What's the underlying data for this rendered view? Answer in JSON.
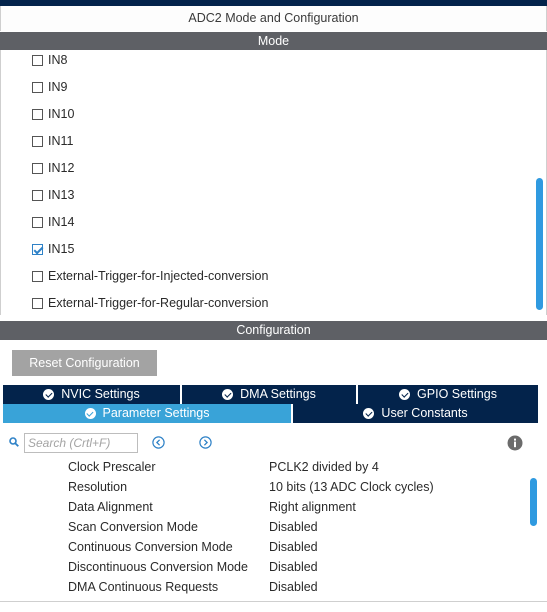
{
  "window": {
    "title": "ADC2 Mode and Configuration"
  },
  "mode": {
    "header": "Mode",
    "items": [
      {
        "label": "IN8",
        "checked": false
      },
      {
        "label": "IN9",
        "checked": false
      },
      {
        "label": "IN10",
        "checked": false
      },
      {
        "label": "IN11",
        "checked": false
      },
      {
        "label": "IN12",
        "checked": false
      },
      {
        "label": "IN13",
        "checked": false
      },
      {
        "label": "IN14",
        "checked": false
      },
      {
        "label": "IN15",
        "checked": true
      },
      {
        "label": "External-Trigger-for-Injected-conversion",
        "checked": false
      },
      {
        "label": "External-Trigger-for-Regular-conversion",
        "checked": false
      }
    ]
  },
  "configuration": {
    "header": "Configuration",
    "reset_button": "Reset Configuration",
    "tabs_row1": [
      {
        "label": "NVIC Settings",
        "icon": "check-circle-icon",
        "active": false
      },
      {
        "label": "DMA Settings",
        "icon": "check-circle-icon",
        "active": false
      },
      {
        "label": "GPIO Settings",
        "icon": "check-circle-icon",
        "active": false
      }
    ],
    "tabs_row2": [
      {
        "label": "Parameter Settings",
        "icon": "check-circle-icon",
        "active": true
      },
      {
        "label": "User Constants",
        "icon": "check-circle-icon",
        "active": false
      }
    ],
    "search": {
      "placeholder": "Search (Crtl+F)",
      "value": ""
    },
    "parameters": [
      {
        "name": "Clock Prescaler",
        "value": "PCLK2 divided by 4"
      },
      {
        "name": "Resolution",
        "value": "10 bits (13 ADC Clock cycles)"
      },
      {
        "name": "Data Alignment",
        "value": "Right alignment"
      },
      {
        "name": "Scan Conversion Mode",
        "value": "Disabled"
      },
      {
        "name": "Continuous Conversion Mode",
        "value": "Disabled"
      },
      {
        "name": "Discontinuous Conversion Mode",
        "value": "Disabled"
      },
      {
        "name": "DMA Continuous Requests",
        "value": "Disabled"
      }
    ]
  },
  "colors": {
    "accent": "#39a3d8",
    "tab_dark": "#03234b",
    "section_header": "#5e6065",
    "scrollbar": "#2f9ae0"
  }
}
